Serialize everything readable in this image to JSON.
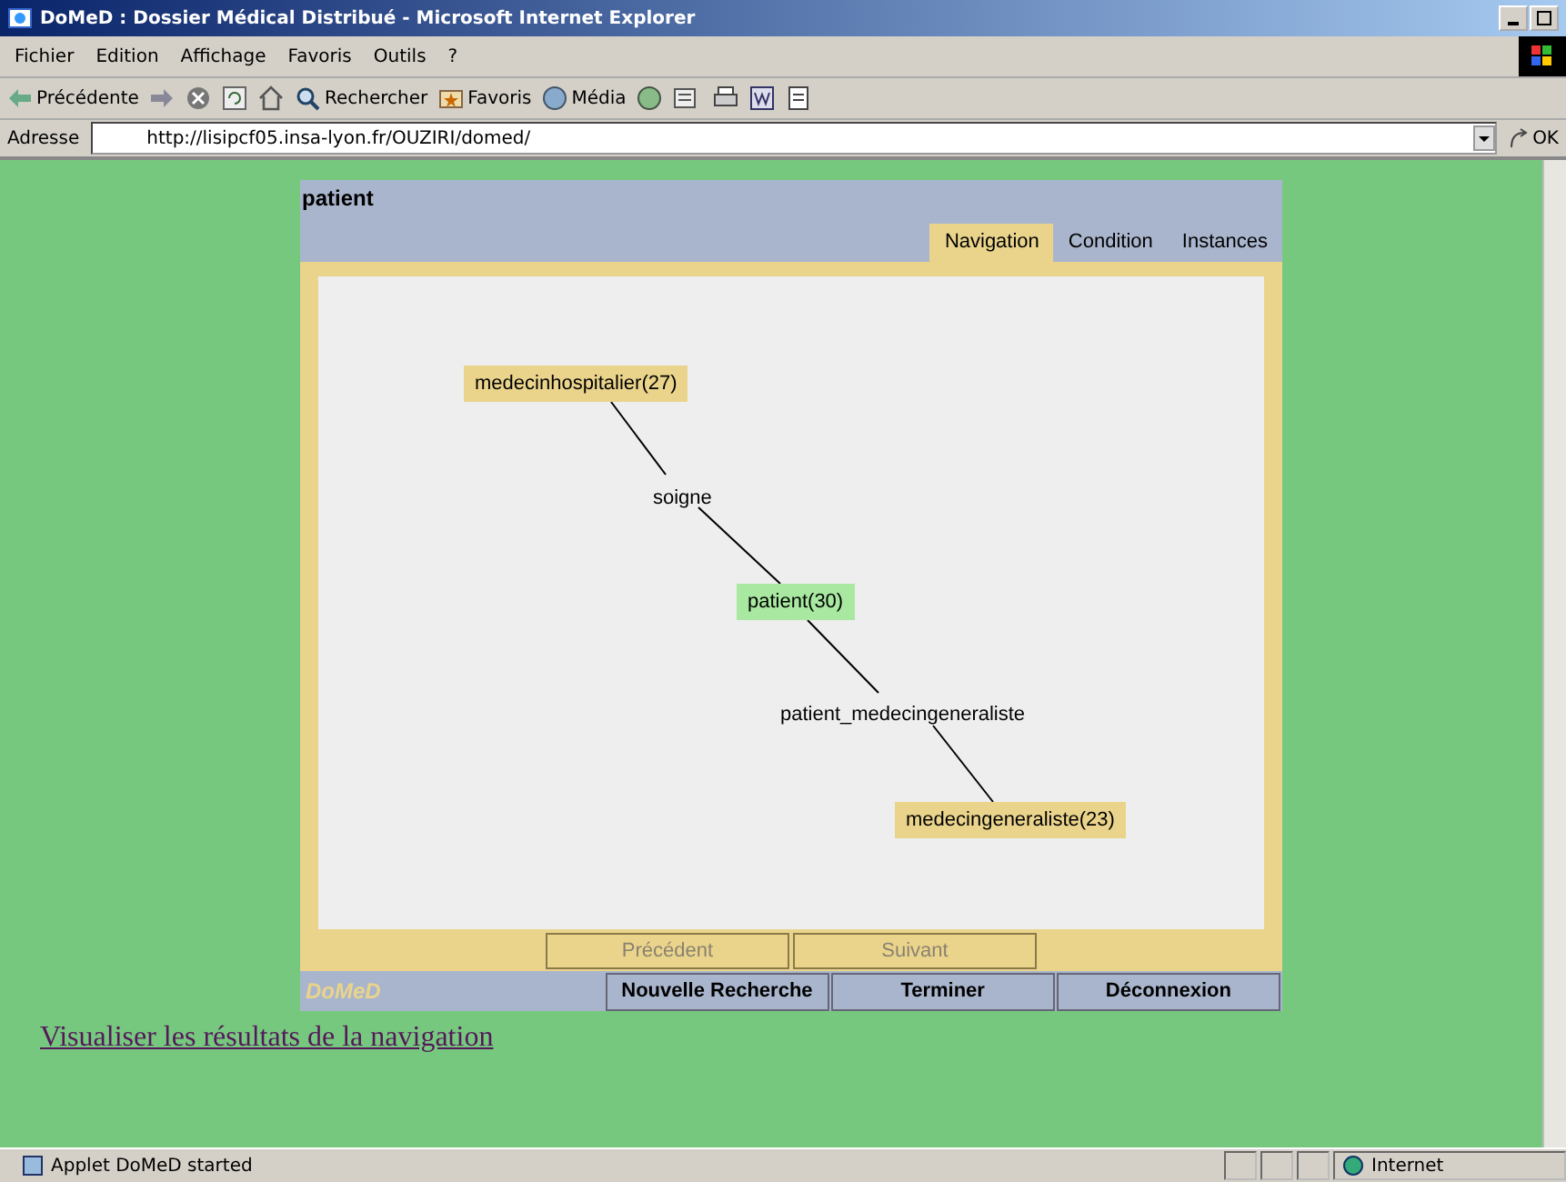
{
  "window": {
    "title": "DoMeD : Dossier Médical Distribué - Microsoft Internet Explorer"
  },
  "menu": [
    "Fichier",
    "Edition",
    "Affichage",
    "Favoris",
    "Outils",
    "?"
  ],
  "toolbar": [
    {
      "kind": "back",
      "label": "Précédente"
    },
    {
      "kind": "search",
      "label": "Rechercher"
    },
    {
      "kind": "favorites",
      "label": "Favoris"
    },
    {
      "kind": "media",
      "label": "Média"
    }
  ],
  "address": {
    "label": "Adresse",
    "value": "http://lisipcf05.insa-lyon.fr/OUZIRI/domed/",
    "go": "OK"
  },
  "applet": {
    "title": "patient",
    "tabs": [
      {
        "label": "Navigation",
        "selected": true
      },
      {
        "label": "Condition",
        "selected": false
      },
      {
        "label": "Instances",
        "selected": false
      }
    ],
    "nodes": [
      {
        "kind": "entity",
        "label": "medecinhospitalier(27)",
        "color": "#ead48c"
      },
      {
        "kind": "relation",
        "label": "soigne"
      },
      {
        "kind": "entity",
        "label": "patient(30)",
        "color": "#a8e8a0"
      },
      {
        "kind": "relation",
        "label": "patient_medecingeneraliste"
      },
      {
        "kind": "entity",
        "label": "medecingeneraliste(23)",
        "color": "#ead48c"
      }
    ],
    "nav_buttons": [
      {
        "label": "Précédent",
        "disabled": true
      },
      {
        "label": "Suivant",
        "disabled": true
      }
    ],
    "logo": "DoMeD",
    "actions": [
      "Nouvelle Recherche",
      "Terminer",
      "Déconnexion"
    ]
  },
  "link": "Visualiser les résultats de la navigation",
  "status_bar": {
    "message": "Applet DoMeD started",
    "zone": "Internet"
  }
}
